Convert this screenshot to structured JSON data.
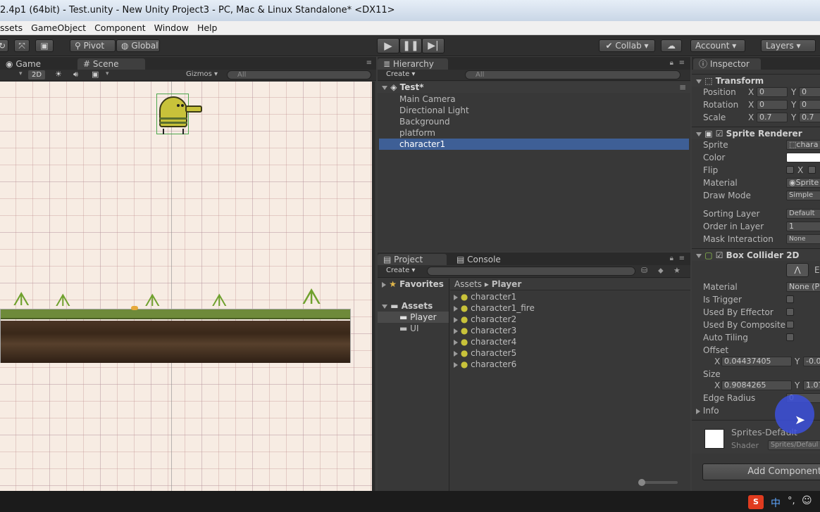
{
  "window": {
    "title": "2.4p1 (64bit) - Test.unity - New Unity Project3 - PC, Mac & Linux Standalone* <DX11>"
  },
  "menu": [
    "ssets",
    "GameObject",
    "Component",
    "Window",
    "Help"
  ],
  "toolbar": {
    "pivot": "Pivot",
    "global": "Global",
    "collab": "Collab ▾",
    "account": "Account",
    "layers": "Layers"
  },
  "scene_panel": {
    "tabs": [
      "Game",
      "Scene"
    ],
    "mode_2d": "2D",
    "gizmos": "Gizmos",
    "search_placeholder": "All"
  },
  "hierarchy": {
    "tab": "Hierarchy",
    "create": "Create",
    "search_placeholder": "All",
    "scene_name": "Test*",
    "items": [
      "Main Camera",
      "Directional Light",
      "Background",
      "platform",
      "character1"
    ],
    "selected": "character1"
  },
  "project": {
    "tabs": [
      "Project",
      "Console"
    ],
    "create": "Create",
    "favorites": "Favorites",
    "assets": "Assets",
    "folders": [
      "Player",
      "UI"
    ],
    "selected_folder": "Player",
    "breadcrumb": [
      "Assets",
      "Player"
    ],
    "files": [
      "character1",
      "character1_fire",
      "character2",
      "character3",
      "character4",
      "character5",
      "character6"
    ]
  },
  "inspector": {
    "tab": "Inspector",
    "transform": {
      "title": "Transform",
      "position": {
        "label": "Position",
        "x": "0",
        "y": "0"
      },
      "rotation": {
        "label": "Rotation",
        "x": "0",
        "y": "0"
      },
      "scale": {
        "label": "Scale",
        "x": "0.7",
        "y": "0.7"
      }
    },
    "sprite_renderer": {
      "title": "Sprite Renderer",
      "sprite_label": "Sprite",
      "sprite_value": "chara",
      "color_label": "Color",
      "flip_label": "Flip",
      "flip_x": "X",
      "material_label": "Material",
      "material_value": "Sprite",
      "draw_mode_label": "Draw Mode",
      "draw_mode_value": "Simple",
      "sorting_layer_label": "Sorting Layer",
      "sorting_layer_value": "Default",
      "order_label": "Order in Layer",
      "order_value": "1",
      "mask_label": "Mask Interaction",
      "mask_value": "None"
    },
    "box_collider": {
      "title": "Box Collider 2D",
      "edit_label": "E",
      "material_label": "Material",
      "material_value": "None (P",
      "is_trigger": "Is Trigger",
      "used_by_effector": "Used By Effector",
      "used_by_composite": "Used By Composite",
      "auto_tiling": "Auto Tiling",
      "offset_label": "Offset",
      "offset_x": "0.04437405",
      "offset_y": "-0.0",
      "size_label": "Size",
      "size_x": "0.9084265",
      "size_y": "1.07",
      "edge_radius_label": "Edge Radius",
      "edge_radius_value": "0",
      "info_label": "Info"
    },
    "material": {
      "name": "Sprites-Default",
      "shader_label": "Shader",
      "shader_value": "Sprites/Defaul"
    },
    "add_component": "Add Component"
  },
  "axis_x": "X",
  "axis_y": "Y",
  "taskbar": {
    "ime": "中"
  }
}
